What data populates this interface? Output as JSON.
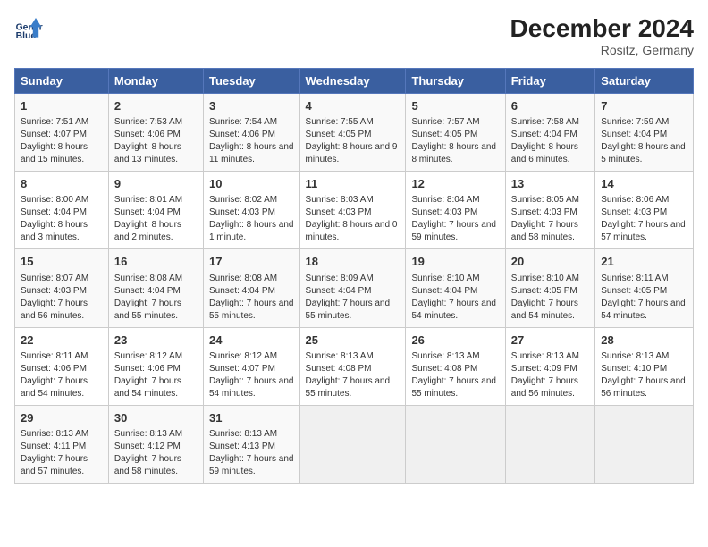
{
  "header": {
    "logo_line1": "General",
    "logo_line2": "Blue",
    "title": "December 2024",
    "subtitle": "Rositz, Germany"
  },
  "days_of_week": [
    "Sunday",
    "Monday",
    "Tuesday",
    "Wednesday",
    "Thursday",
    "Friday",
    "Saturday"
  ],
  "weeks": [
    [
      {
        "day": "1",
        "sunrise": "7:51 AM",
        "sunset": "4:07 PM",
        "daylight": "8 hours and 15 minutes."
      },
      {
        "day": "2",
        "sunrise": "7:53 AM",
        "sunset": "4:06 PM",
        "daylight": "8 hours and 13 minutes."
      },
      {
        "day": "3",
        "sunrise": "7:54 AM",
        "sunset": "4:06 PM",
        "daylight": "8 hours and 11 minutes."
      },
      {
        "day": "4",
        "sunrise": "7:55 AM",
        "sunset": "4:05 PM",
        "daylight": "8 hours and 9 minutes."
      },
      {
        "day": "5",
        "sunrise": "7:57 AM",
        "sunset": "4:05 PM",
        "daylight": "8 hours and 8 minutes."
      },
      {
        "day": "6",
        "sunrise": "7:58 AM",
        "sunset": "4:04 PM",
        "daylight": "8 hours and 6 minutes."
      },
      {
        "day": "7",
        "sunrise": "7:59 AM",
        "sunset": "4:04 PM",
        "daylight": "8 hours and 5 minutes."
      }
    ],
    [
      {
        "day": "8",
        "sunrise": "8:00 AM",
        "sunset": "4:04 PM",
        "daylight": "8 hours and 3 minutes."
      },
      {
        "day": "9",
        "sunrise": "8:01 AM",
        "sunset": "4:04 PM",
        "daylight": "8 hours and 2 minutes."
      },
      {
        "day": "10",
        "sunrise": "8:02 AM",
        "sunset": "4:03 PM",
        "daylight": "8 hours and 1 minute."
      },
      {
        "day": "11",
        "sunrise": "8:03 AM",
        "sunset": "4:03 PM",
        "daylight": "8 hours and 0 minutes."
      },
      {
        "day": "12",
        "sunrise": "8:04 AM",
        "sunset": "4:03 PM",
        "daylight": "7 hours and 59 minutes."
      },
      {
        "day": "13",
        "sunrise": "8:05 AM",
        "sunset": "4:03 PM",
        "daylight": "7 hours and 58 minutes."
      },
      {
        "day": "14",
        "sunrise": "8:06 AM",
        "sunset": "4:03 PM",
        "daylight": "7 hours and 57 minutes."
      }
    ],
    [
      {
        "day": "15",
        "sunrise": "8:07 AM",
        "sunset": "4:03 PM",
        "daylight": "7 hours and 56 minutes."
      },
      {
        "day": "16",
        "sunrise": "8:08 AM",
        "sunset": "4:04 PM",
        "daylight": "7 hours and 55 minutes."
      },
      {
        "day": "17",
        "sunrise": "8:08 AM",
        "sunset": "4:04 PM",
        "daylight": "7 hours and 55 minutes."
      },
      {
        "day": "18",
        "sunrise": "8:09 AM",
        "sunset": "4:04 PM",
        "daylight": "7 hours and 55 minutes."
      },
      {
        "day": "19",
        "sunrise": "8:10 AM",
        "sunset": "4:04 PM",
        "daylight": "7 hours and 54 minutes."
      },
      {
        "day": "20",
        "sunrise": "8:10 AM",
        "sunset": "4:05 PM",
        "daylight": "7 hours and 54 minutes."
      },
      {
        "day": "21",
        "sunrise": "8:11 AM",
        "sunset": "4:05 PM",
        "daylight": "7 hours and 54 minutes."
      }
    ],
    [
      {
        "day": "22",
        "sunrise": "8:11 AM",
        "sunset": "4:06 PM",
        "daylight": "7 hours and 54 minutes."
      },
      {
        "day": "23",
        "sunrise": "8:12 AM",
        "sunset": "4:06 PM",
        "daylight": "7 hours and 54 minutes."
      },
      {
        "day": "24",
        "sunrise": "8:12 AM",
        "sunset": "4:07 PM",
        "daylight": "7 hours and 54 minutes."
      },
      {
        "day": "25",
        "sunrise": "8:13 AM",
        "sunset": "4:08 PM",
        "daylight": "7 hours and 55 minutes."
      },
      {
        "day": "26",
        "sunrise": "8:13 AM",
        "sunset": "4:08 PM",
        "daylight": "7 hours and 55 minutes."
      },
      {
        "day": "27",
        "sunrise": "8:13 AM",
        "sunset": "4:09 PM",
        "daylight": "7 hours and 56 minutes."
      },
      {
        "day": "28",
        "sunrise": "8:13 AM",
        "sunset": "4:10 PM",
        "daylight": "7 hours and 56 minutes."
      }
    ],
    [
      {
        "day": "29",
        "sunrise": "8:13 AM",
        "sunset": "4:11 PM",
        "daylight": "7 hours and 57 minutes."
      },
      {
        "day": "30",
        "sunrise": "8:13 AM",
        "sunset": "4:12 PM",
        "daylight": "7 hours and 58 minutes."
      },
      {
        "day": "31",
        "sunrise": "8:13 AM",
        "sunset": "4:13 PM",
        "daylight": "7 hours and 59 minutes."
      },
      null,
      null,
      null,
      null
    ]
  ]
}
